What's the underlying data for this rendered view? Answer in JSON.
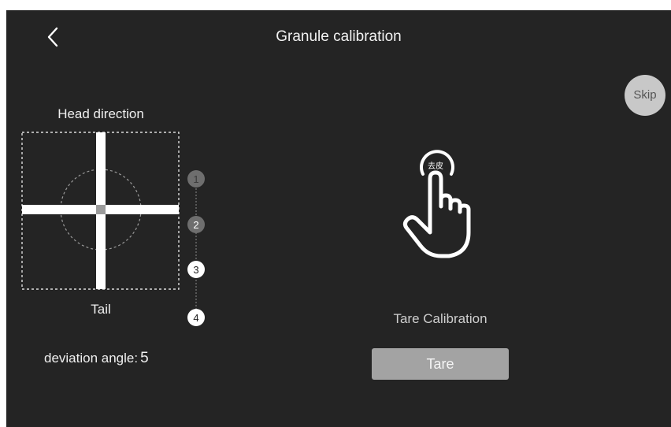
{
  "header": {
    "title": "Granule calibration",
    "back_icon": "chevron-left-icon"
  },
  "skip_label": "Skip",
  "diagram": {
    "head_label": "Head direction",
    "tail_label": "Tail",
    "steps": [
      "1",
      "2",
      "3",
      "4"
    ],
    "active_steps": [
      "3",
      "4"
    ]
  },
  "deviation": {
    "label": "deviation angle:",
    "value": "5"
  },
  "hand_icon": {
    "name": "tap-hand-icon",
    "badge": "去皮"
  },
  "tare": {
    "caption": "Tare Calibration",
    "button_label": "Tare"
  },
  "colors": {
    "background": "#242424",
    "button": "#a3a3a3",
    "skip": "#c8c8c8",
    "inactive_step": "#6e6e6e",
    "active_step": "#ffffff"
  }
}
